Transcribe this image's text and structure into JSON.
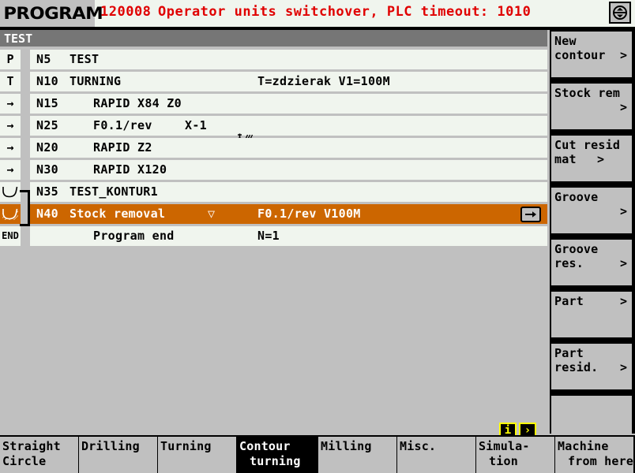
{
  "header": {
    "mode_title": "PROGRAM",
    "alarm_number": "120008",
    "alarm_text": "Operator units switchover, PLC timeout: 1010",
    "icon": "channel-switch-icon"
  },
  "namebar": {
    "program_name": "TEST"
  },
  "colors": {
    "selection": "#cc6600",
    "alarm": "#e00000",
    "panel": "#c0c0c0",
    "list_bg": "#f0f5ee",
    "namebar": "#767676",
    "accent_yellow": "#ffff00"
  },
  "program": {
    "rows": [
      {
        "icon": "program-head-icon",
        "icon_glyph": "P",
        "block": "N5",
        "command": "TEST",
        "indent": 0,
        "mid": "",
        "right": "",
        "selected": false
      },
      {
        "icon": "tool-icon",
        "icon_glyph": "T",
        "block": "N10",
        "command": "TURNING",
        "indent": 0,
        "mid": "",
        "right": "T=zdzierak V1=100M",
        "selected": false
      },
      {
        "icon": "rapid-arrow-icon",
        "icon_glyph": "→",
        "block": "N15",
        "command": "RAPID X84 Z0",
        "indent": 1,
        "mid": "",
        "right": "",
        "selected": false
      },
      {
        "icon": "rapid-arrow-icon",
        "icon_glyph": "→",
        "block": "N25",
        "command": "F0.1/rev",
        "indent": 1,
        "mid": "",
        "right": "",
        "inline_icon": "cutting-tool-icon",
        "after_icon": "X-1",
        "selected": false
      },
      {
        "icon": "rapid-arrow-icon",
        "icon_glyph": "→",
        "block": "N20",
        "command": "RAPID Z2",
        "indent": 1,
        "mid": "",
        "right": "",
        "selected": false
      },
      {
        "icon": "rapid-arrow-icon",
        "icon_glyph": "→",
        "block": "N30",
        "command": "RAPID X120",
        "indent": 1,
        "mid": "",
        "right": "",
        "selected": false
      },
      {
        "icon": "contour-curve-icon",
        "icon_glyph": "",
        "block": "N35",
        "command": "TEST_KONTUR1",
        "indent": 0,
        "mid": "",
        "right": "",
        "selected": false
      },
      {
        "icon": "stock-removal-icon",
        "icon_glyph": "",
        "block": "N40",
        "command": "Stock removal",
        "indent": 0,
        "mid": "▽",
        "right": "F0.1/rev V100M",
        "selected": true,
        "expand_button": "row-expand-arrow"
      },
      {
        "icon": "program-end-icon",
        "icon_glyph": "END",
        "block": "",
        "command": "Program end",
        "indent": 1,
        "mid": "",
        "right": "N=1",
        "selected": false
      }
    ]
  },
  "mini_buttons": [
    {
      "name": "info-button",
      "label": "i"
    },
    {
      "name": "next-page-button",
      "label": "›"
    }
  ],
  "vertical_softkeys": [
    {
      "line1": "New",
      "line2": "contour",
      "chevron": ">",
      "chev_pos": "line2",
      "name": "new-contour"
    },
    {
      "line1": "Stock rem",
      "line2": "",
      "chevron": ">",
      "chev_pos": "line2",
      "name": "stock-removal"
    },
    {
      "line1": "Cut resid",
      "line2": "mat",
      "chevron": ">",
      "chev_pos": "line2",
      "name": "cut-residual-material"
    },
    {
      "line1": "Groove",
      "line2": "",
      "chevron": ">",
      "chev_pos": "line2",
      "name": "groove"
    },
    {
      "line1": "Groove",
      "line2": "res.",
      "chevron": ">",
      "chev_pos": "line2",
      "name": "groove-residual"
    },
    {
      "line1": "Part",
      "line2": "",
      "chevron": ">",
      "chev_pos": "line1",
      "name": "part"
    },
    {
      "line1": "Part",
      "line2": "resid.",
      "chevron": ">",
      "chev_pos": "line2",
      "name": "part-residual"
    },
    {
      "line1": "",
      "line2": "",
      "chevron": "",
      "chev_pos": "",
      "name": "empty-softkey"
    }
  ],
  "horizontal_softkeys": [
    {
      "line1": "Straight",
      "line2": "Circle",
      "active": false,
      "name": "straight-circle"
    },
    {
      "line1": "Drilling",
      "line2": "",
      "active": false,
      "name": "drilling"
    },
    {
      "line1": "Turning",
      "line2": "",
      "active": false,
      "name": "turning"
    },
    {
      "line1": "Contour",
      "line2": "turning",
      "active": true,
      "name": "contour-turning"
    },
    {
      "line1": "Milling",
      "line2": "",
      "active": false,
      "name": "milling"
    },
    {
      "line1": "Misc.",
      "line2": "",
      "active": false,
      "name": "misc"
    },
    {
      "line1": "Simula-",
      "line2": "tion",
      "active": false,
      "name": "simulation"
    },
    {
      "line1": "Machine",
      "line2": "from here",
      "active": false,
      "name": "machine-from-here"
    }
  ]
}
